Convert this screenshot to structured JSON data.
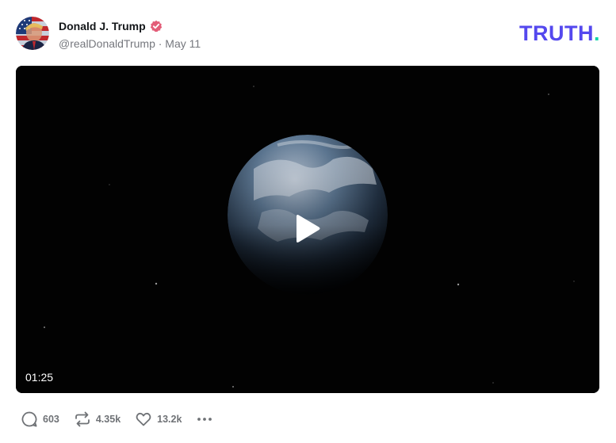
{
  "post": {
    "author_name": "Donald J. Trump",
    "handle_line": "@realDonaldTrump · May 11",
    "verified": true
  },
  "brand": {
    "logo_text": "TRUTH",
    "logo_dot": ".",
    "primary_color": "#5448ee",
    "dot_color": "#0ed4a6"
  },
  "video": {
    "duration": "01:25",
    "play_icon": "play-icon"
  },
  "actions": {
    "reply_count": "603",
    "retruth_count": "4.35k",
    "like_count": "13.2k",
    "more_icon": "more-icon"
  }
}
